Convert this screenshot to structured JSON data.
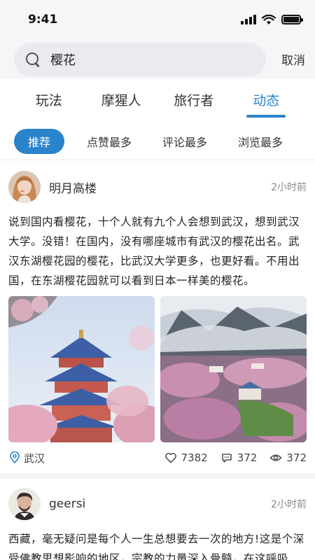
{
  "status": {
    "time": "9:41"
  },
  "search": {
    "value": "樱花",
    "cancel": "取消"
  },
  "tabs": [
    {
      "label": "玩法",
      "active": false
    },
    {
      "label": "摩猩人",
      "active": false
    },
    {
      "label": "旅行者",
      "active": false
    },
    {
      "label": "动态",
      "active": true
    }
  ],
  "filters": [
    {
      "label": "推荐",
      "active": true
    },
    {
      "label": "点赞最多",
      "active": false
    },
    {
      "label": "评论最多",
      "active": false
    },
    {
      "label": "浏览最多",
      "active": false
    }
  ],
  "posts": [
    {
      "author": "明月高楼",
      "time": "2小时前",
      "text": "说到国内看樱花，十个人就有九个人会想到武汉，想到武汉大学。没错！在国内，没有哪座城市有武汉的樱花出名。武汉东湖樱花园的樱花，比武汉大学更多，也更好看。不用出国，在东湖樱花园就可以看到日本一样美的樱花。",
      "location": "武汉",
      "likes": "7382",
      "comments": "372",
      "views": "372"
    },
    {
      "author": "geersi",
      "time": "2小时前",
      "text": "西藏，毫无疑问是每个人一生总想要去一次的地方!这是个深受佛教思想影响的地区，宗教的力量深入骨髓，在这呼吸"
    }
  ],
  "colors": {
    "accent": "#2a84cc",
    "background": "#ffffff",
    "header_bg": "#f5f6f8"
  }
}
